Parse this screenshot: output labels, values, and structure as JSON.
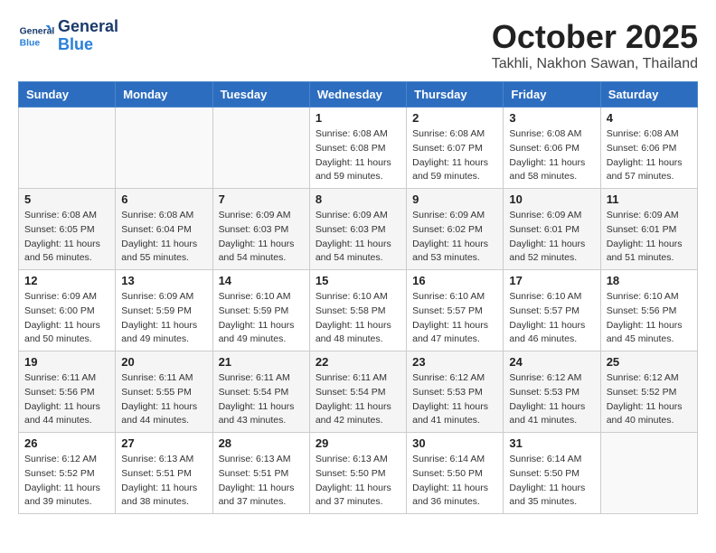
{
  "header": {
    "logo_line1": "General",
    "logo_line2": "Blue",
    "month": "October 2025",
    "location": "Takhli, Nakhon Sawan, Thailand"
  },
  "weekdays": [
    "Sunday",
    "Monday",
    "Tuesday",
    "Wednesday",
    "Thursday",
    "Friday",
    "Saturday"
  ],
  "weeks": [
    [
      {
        "day": "",
        "info": ""
      },
      {
        "day": "",
        "info": ""
      },
      {
        "day": "",
        "info": ""
      },
      {
        "day": "1",
        "sunrise": "6:08 AM",
        "sunset": "6:08 PM",
        "daylight": "11 hours and 59 minutes."
      },
      {
        "day": "2",
        "sunrise": "6:08 AM",
        "sunset": "6:07 PM",
        "daylight": "11 hours and 59 minutes."
      },
      {
        "day": "3",
        "sunrise": "6:08 AM",
        "sunset": "6:06 PM",
        "daylight": "11 hours and 58 minutes."
      },
      {
        "day": "4",
        "sunrise": "6:08 AM",
        "sunset": "6:06 PM",
        "daylight": "11 hours and 57 minutes."
      }
    ],
    [
      {
        "day": "5",
        "sunrise": "6:08 AM",
        "sunset": "6:05 PM",
        "daylight": "11 hours and 56 minutes."
      },
      {
        "day": "6",
        "sunrise": "6:08 AM",
        "sunset": "6:04 PM",
        "daylight": "11 hours and 55 minutes."
      },
      {
        "day": "7",
        "sunrise": "6:09 AM",
        "sunset": "6:03 PM",
        "daylight": "11 hours and 54 minutes."
      },
      {
        "day": "8",
        "sunrise": "6:09 AM",
        "sunset": "6:03 PM",
        "daylight": "11 hours and 54 minutes."
      },
      {
        "day": "9",
        "sunrise": "6:09 AM",
        "sunset": "6:02 PM",
        "daylight": "11 hours and 53 minutes."
      },
      {
        "day": "10",
        "sunrise": "6:09 AM",
        "sunset": "6:01 PM",
        "daylight": "11 hours and 52 minutes."
      },
      {
        "day": "11",
        "sunrise": "6:09 AM",
        "sunset": "6:01 PM",
        "daylight": "11 hours and 51 minutes."
      }
    ],
    [
      {
        "day": "12",
        "sunrise": "6:09 AM",
        "sunset": "6:00 PM",
        "daylight": "11 hours and 50 minutes."
      },
      {
        "day": "13",
        "sunrise": "6:09 AM",
        "sunset": "5:59 PM",
        "daylight": "11 hours and 49 minutes."
      },
      {
        "day": "14",
        "sunrise": "6:10 AM",
        "sunset": "5:59 PM",
        "daylight": "11 hours and 49 minutes."
      },
      {
        "day": "15",
        "sunrise": "6:10 AM",
        "sunset": "5:58 PM",
        "daylight": "11 hours and 48 minutes."
      },
      {
        "day": "16",
        "sunrise": "6:10 AM",
        "sunset": "5:57 PM",
        "daylight": "11 hours and 47 minutes."
      },
      {
        "day": "17",
        "sunrise": "6:10 AM",
        "sunset": "5:57 PM",
        "daylight": "11 hours and 46 minutes."
      },
      {
        "day": "18",
        "sunrise": "6:10 AM",
        "sunset": "5:56 PM",
        "daylight": "11 hours and 45 minutes."
      }
    ],
    [
      {
        "day": "19",
        "sunrise": "6:11 AM",
        "sunset": "5:56 PM",
        "daylight": "11 hours and 44 minutes."
      },
      {
        "day": "20",
        "sunrise": "6:11 AM",
        "sunset": "5:55 PM",
        "daylight": "11 hours and 44 minutes."
      },
      {
        "day": "21",
        "sunrise": "6:11 AM",
        "sunset": "5:54 PM",
        "daylight": "11 hours and 43 minutes."
      },
      {
        "day": "22",
        "sunrise": "6:11 AM",
        "sunset": "5:54 PM",
        "daylight": "11 hours and 42 minutes."
      },
      {
        "day": "23",
        "sunrise": "6:12 AM",
        "sunset": "5:53 PM",
        "daylight": "11 hours and 41 minutes."
      },
      {
        "day": "24",
        "sunrise": "6:12 AM",
        "sunset": "5:53 PM",
        "daylight": "11 hours and 41 minutes."
      },
      {
        "day": "25",
        "sunrise": "6:12 AM",
        "sunset": "5:52 PM",
        "daylight": "11 hours and 40 minutes."
      }
    ],
    [
      {
        "day": "26",
        "sunrise": "6:12 AM",
        "sunset": "5:52 PM",
        "daylight": "11 hours and 39 minutes."
      },
      {
        "day": "27",
        "sunrise": "6:13 AM",
        "sunset": "5:51 PM",
        "daylight": "11 hours and 38 minutes."
      },
      {
        "day": "28",
        "sunrise": "6:13 AM",
        "sunset": "5:51 PM",
        "daylight": "11 hours and 37 minutes."
      },
      {
        "day": "29",
        "sunrise": "6:13 AM",
        "sunset": "5:50 PM",
        "daylight": "11 hours and 37 minutes."
      },
      {
        "day": "30",
        "sunrise": "6:14 AM",
        "sunset": "5:50 PM",
        "daylight": "11 hours and 36 minutes."
      },
      {
        "day": "31",
        "sunrise": "6:14 AM",
        "sunset": "5:50 PM",
        "daylight": "11 hours and 35 minutes."
      },
      {
        "day": "",
        "info": ""
      }
    ]
  ]
}
